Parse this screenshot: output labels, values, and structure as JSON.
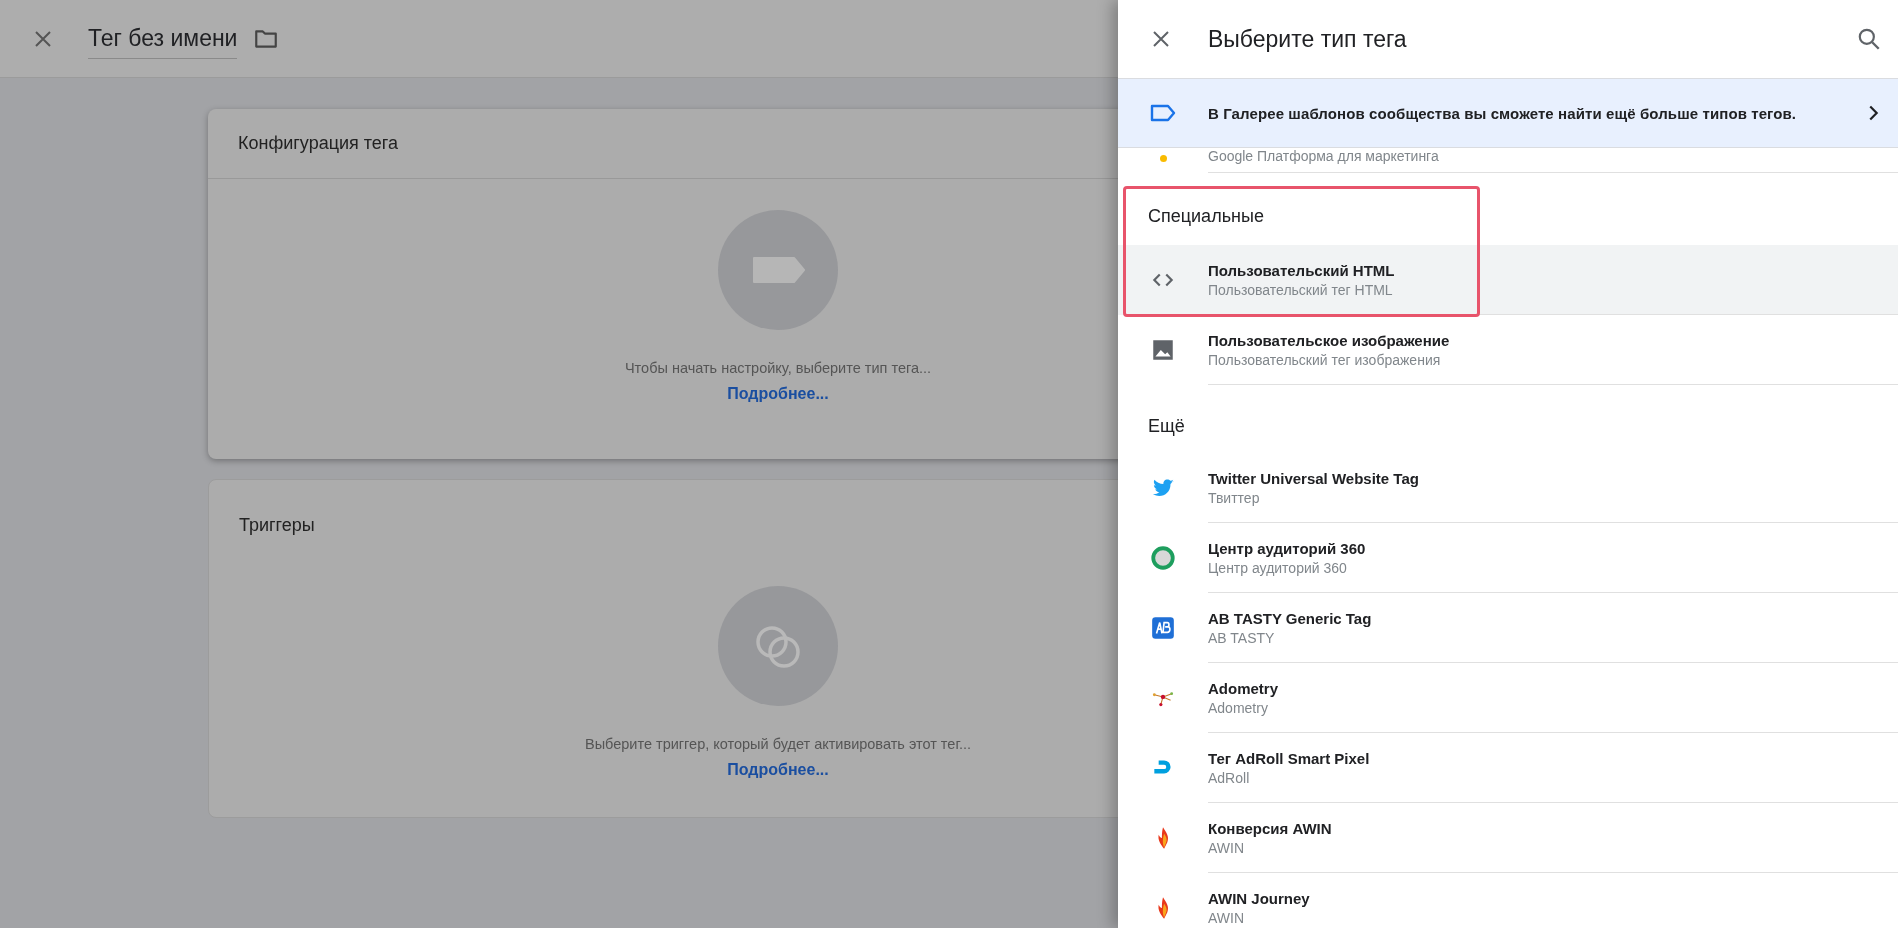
{
  "editor": {
    "title": "Тег без имени"
  },
  "cards": [
    {
      "title": "Конфигурация тега",
      "hint": "Чтобы начать настройку, выберите тип тега...",
      "link": "Подробнее..."
    },
    {
      "title": "Триггеры",
      "hint": "Выберите триггер, который будет активировать этот тег...",
      "link": "Подробнее..."
    }
  ],
  "panel": {
    "title": "Выберите тип тега",
    "banner": "В Галерее шаблонов сообщества вы сможете найти ещё больше типов тегов.",
    "partial_row": {
      "subtitle": "Google Платформа для маркетинга"
    },
    "sections": [
      {
        "heading": "Специальные",
        "highlighted": true,
        "items": [
          {
            "title": "Пользовательский HTML",
            "subtitle": "Пользовательский тег HTML",
            "hovered": true
          },
          {
            "title": "Пользовательское изображение",
            "subtitle": "Пользовательский тег изображения",
            "hovered": false
          }
        ]
      },
      {
        "heading": "Ещё",
        "highlighted": false,
        "items": [
          {
            "title": "Twitter Universal Website Tag",
            "subtitle": "Твиттер",
            "hovered": false
          },
          {
            "title": "Центр аудиторий 360",
            "subtitle": "Центр аудиторий 360",
            "hovered": false
          },
          {
            "title": "AB TASTY Generic Tag",
            "subtitle": "AB TASTY",
            "hovered": false
          },
          {
            "title": "Adometry",
            "subtitle": "Adometry",
            "hovered": false
          },
          {
            "title": "Тег AdRoll Smart Pixel",
            "subtitle": "AdRoll",
            "hovered": false
          },
          {
            "title": "Конверсия AWIN",
            "subtitle": "AWIN",
            "hovered": false
          },
          {
            "title": "AWIN Journey",
            "subtitle": "AWIN",
            "hovered": false
          }
        ]
      }
    ]
  }
}
